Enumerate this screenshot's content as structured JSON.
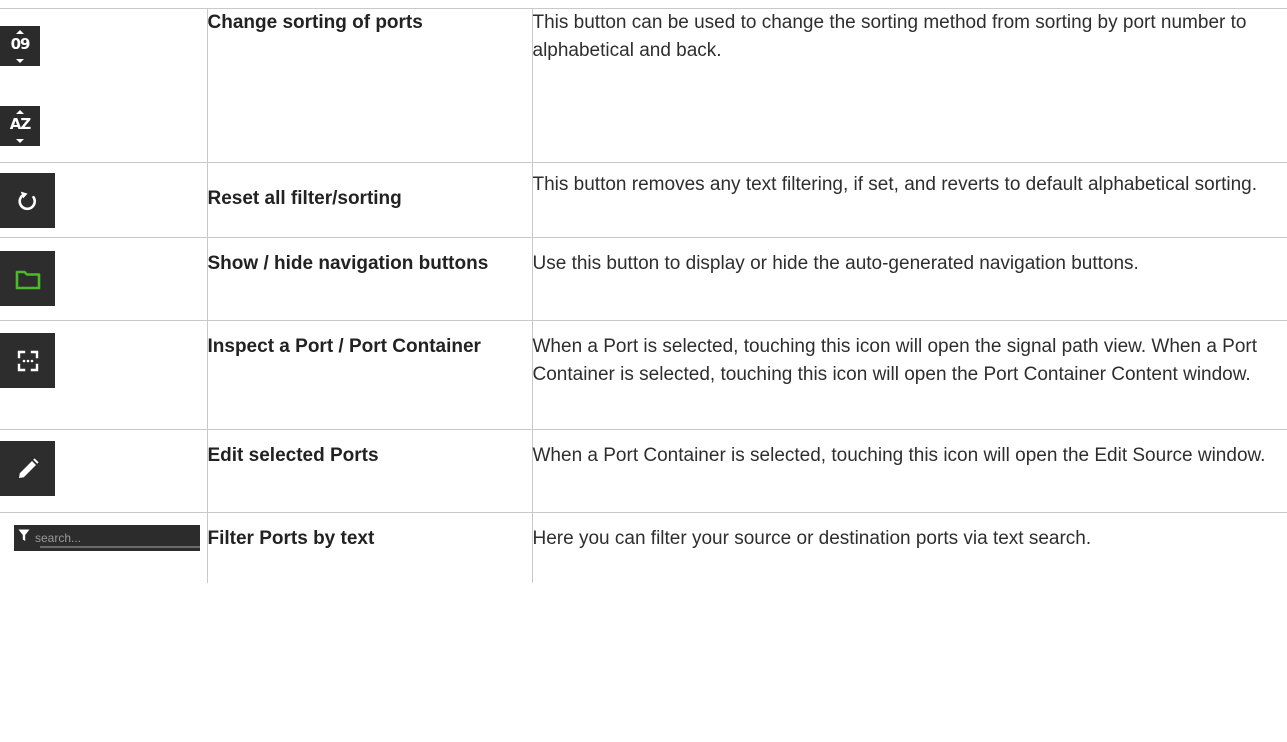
{
  "rows": [
    {
      "icon_names": [
        "sort-numeric-icon",
        "sort-alpha-icon"
      ],
      "icon_labels": [
        "09",
        "AZ"
      ],
      "name": "Change sorting of ports",
      "description": "This button can be used to change the sorting method from sorting by port number to alphabetical and back."
    },
    {
      "icon_names": [
        "reset-icon"
      ],
      "name": "Reset all filter/sorting",
      "description": "This button removes any text filtering, if set, and reverts to default alphabetical sorting."
    },
    {
      "icon_names": [
        "folder-icon"
      ],
      "name": "Show / hide navigation buttons",
      "description": "Use this button to display or hide the auto-generated navigation buttons."
    },
    {
      "icon_names": [
        "inspect-icon"
      ],
      "name": "Inspect a Port / Port Container",
      "description": "When a Port is selected, touching this icon will open the signal path view. When a Port Container is selected, touching this icon will open the Port Container Content window."
    },
    {
      "icon_names": [
        "pencil-icon"
      ],
      "name": "Edit selected Ports",
      "description": "When a Port Container is selected, touching this icon will open the Edit Source window."
    },
    {
      "icon_names": [
        "filter-icon"
      ],
      "search_placeholder": "search...",
      "name": "Filter Ports by text",
      "description": "Here you can filter your source or destination ports via text search."
    }
  ],
  "colors": {
    "icon_background": "#2d2d2d",
    "icon_foreground": "#ffffff",
    "folder_green": "#4cbb2a",
    "border": "#c9c9c9",
    "text": "#222222"
  }
}
